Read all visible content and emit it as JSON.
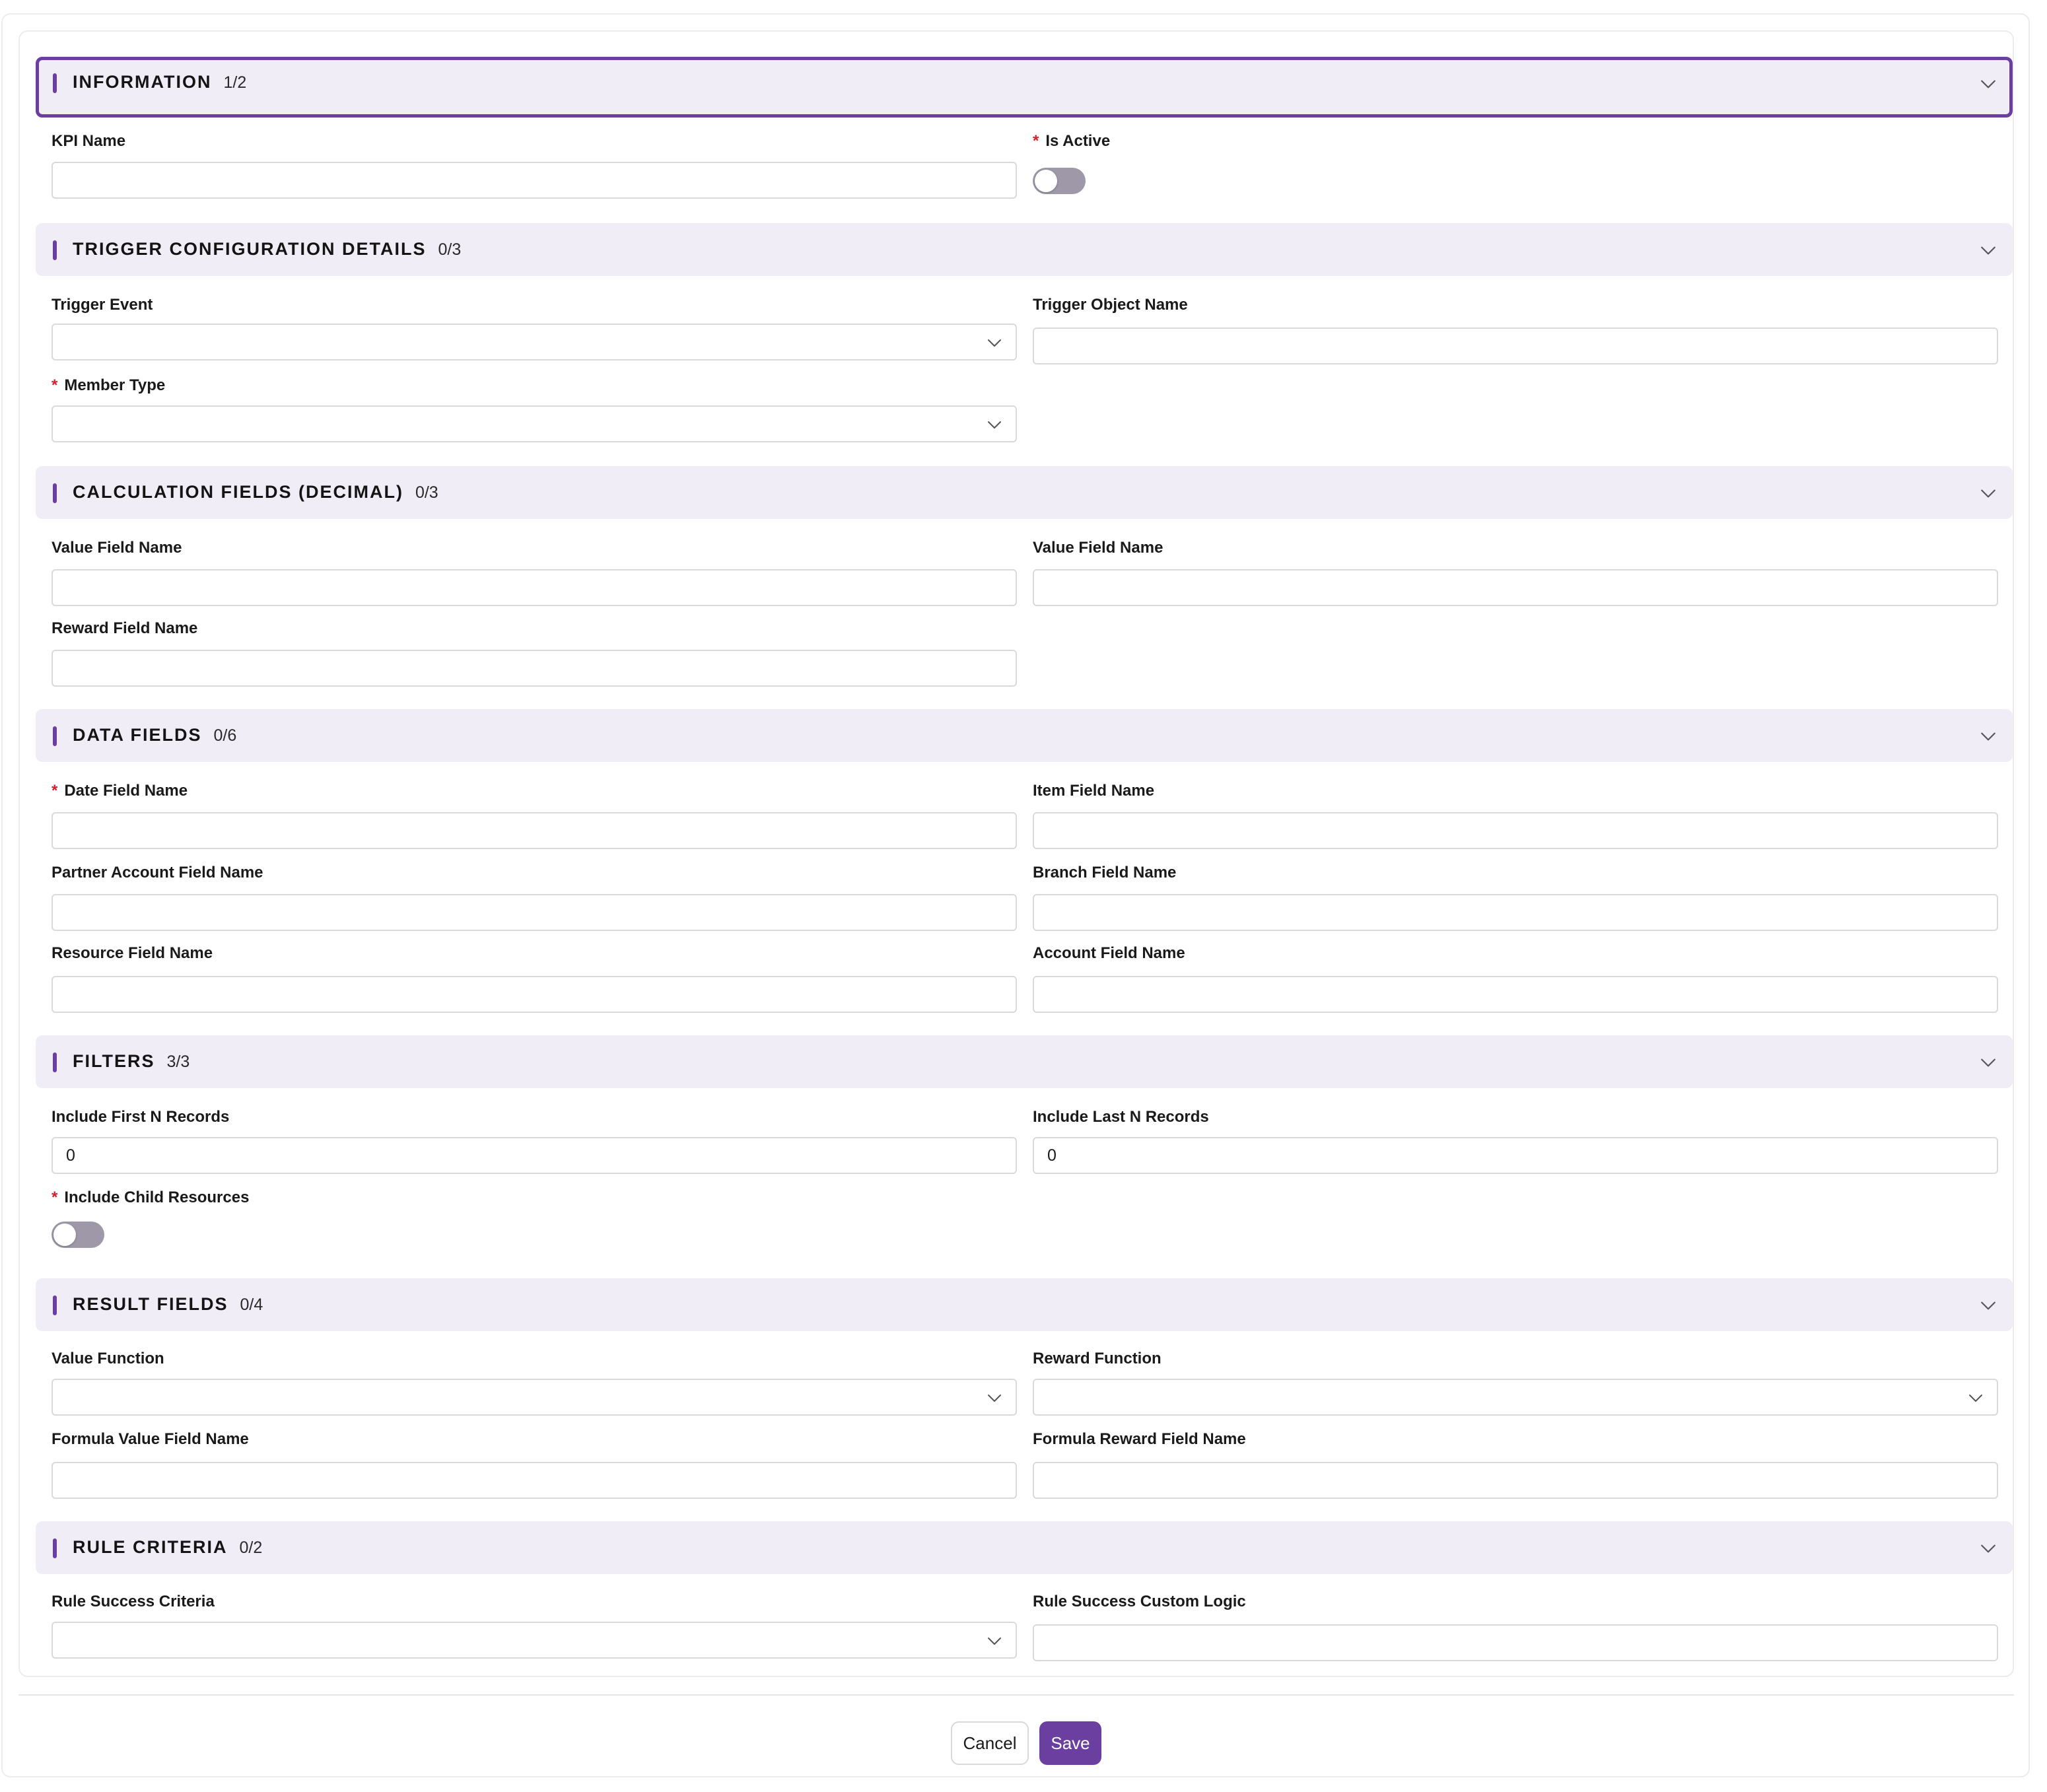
{
  "colors": {
    "accent": "#6b3fa0",
    "required": "#d4202a",
    "header_bg": "#f0edf7"
  },
  "sections": {
    "information": {
      "title": "INFORMATION",
      "count": "1/2",
      "fields": {
        "kpi_name": {
          "label": "KPI Name",
          "value": ""
        },
        "is_active": {
          "label": "Is Active",
          "on": false
        }
      }
    },
    "trigger": {
      "title": "TRIGGER CONFIGURATION DETAILS",
      "count": "0/3",
      "fields": {
        "trigger_event": {
          "label": "Trigger Event",
          "value": ""
        },
        "trigger_object_name": {
          "label": "Trigger Object Name",
          "value": ""
        },
        "member_type": {
          "label": "Member Type",
          "value": ""
        }
      }
    },
    "calculation": {
      "title": "CALCULATION FIELDS (DECIMAL)",
      "count": "0/3",
      "fields": {
        "value_field_name_1": {
          "label": "Value Field Name",
          "value": ""
        },
        "value_field_name_2": {
          "label": "Value Field Name",
          "value": ""
        },
        "reward_field_name": {
          "label": "Reward Field Name",
          "value": ""
        }
      }
    },
    "data": {
      "title": "DATA FIELDS",
      "count": "0/6",
      "fields": {
        "date_field_name": {
          "label": "Date Field Name",
          "value": ""
        },
        "item_field_name": {
          "label": "Item Field Name",
          "value": ""
        },
        "partner_account_field_name": {
          "label": "Partner Account Field Name",
          "value": ""
        },
        "branch_field_name": {
          "label": "Branch Field Name",
          "value": ""
        },
        "resource_field_name": {
          "label": "Resource Field Name",
          "value": ""
        },
        "account_field_name": {
          "label": "Account Field Name",
          "value": ""
        }
      }
    },
    "filters": {
      "title": "FILTERS",
      "count": "3/3",
      "fields": {
        "include_first_n": {
          "label": "Include First N Records",
          "value": "0"
        },
        "include_last_n": {
          "label": "Include Last N Records",
          "value": "0"
        },
        "include_child_resources": {
          "label": "Include Child Resources",
          "on": false
        }
      }
    },
    "result": {
      "title": "RESULT FIELDS",
      "count": "0/4",
      "fields": {
        "value_function": {
          "label": "Value Function",
          "value": ""
        },
        "reward_function": {
          "label": "Reward Function",
          "value": ""
        },
        "formula_value_field_name": {
          "label": "Formula Value Field Name",
          "value": ""
        },
        "formula_reward_field_name": {
          "label": "Formula Reward Field Name",
          "value": ""
        }
      }
    },
    "rule": {
      "title": "RULE CRITERIA",
      "count": "0/2",
      "fields": {
        "rule_success_criteria": {
          "label": "Rule Success Criteria",
          "value": ""
        },
        "rule_success_custom_logic": {
          "label": "Rule Success Custom Logic",
          "value": ""
        }
      }
    }
  },
  "required_marker": "*",
  "footer": {
    "cancel_label": "Cancel",
    "save_label": "Save"
  }
}
